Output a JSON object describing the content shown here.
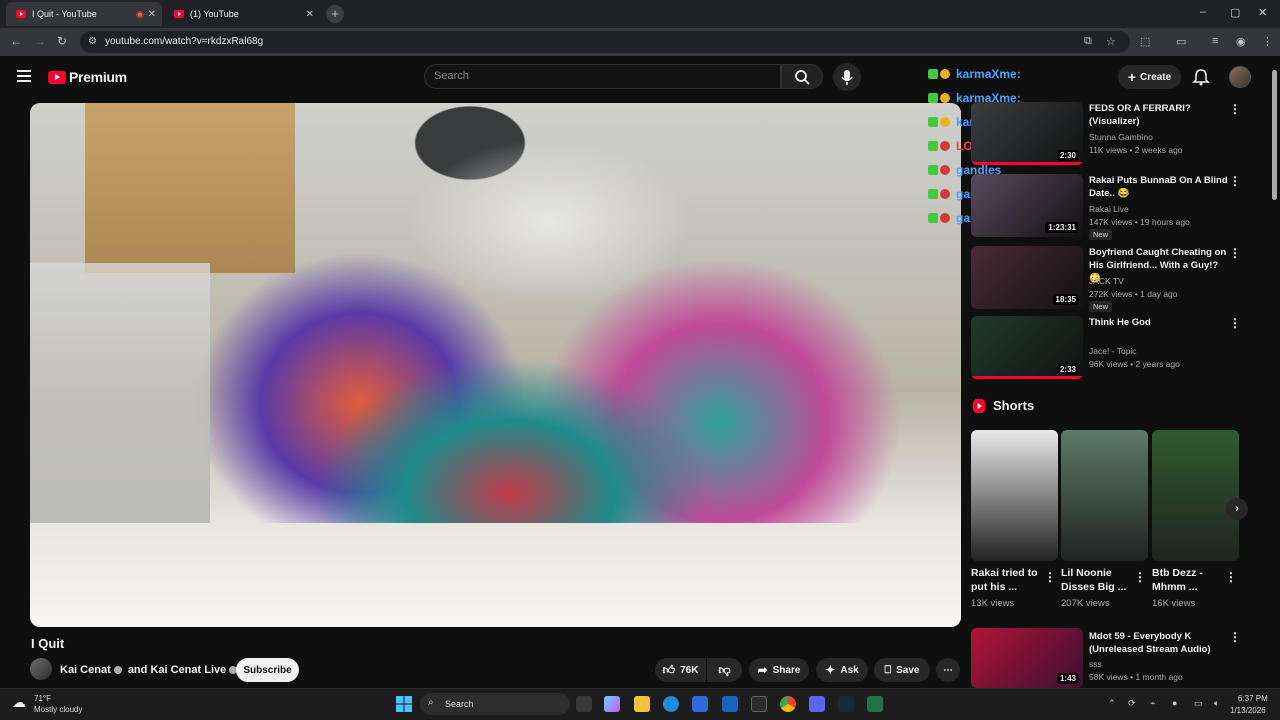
{
  "browser": {
    "tabs": [
      {
        "label": "I Quit - YouTube",
        "active": true
      },
      {
        "label": "(1) YouTube",
        "active": false
      }
    ],
    "new_tab": "+",
    "url": "youtube.com/watch?v=rkdzxRal68g",
    "window_controls": [
      "–",
      "▢",
      "✕"
    ]
  },
  "header": {
    "brand": "Premium",
    "search_placeholder": "Search",
    "create_label": "Create"
  },
  "chat": [
    {
      "user": "karmaXme:",
      "color": "#4da3ff"
    },
    {
      "user": "karmaXme:",
      "color": "#4da3ff"
    },
    {
      "user": "karmaXme:",
      "color": "#4da3ff"
    },
    {
      "user": "LOrdRick",
      "color": "#ff4040"
    },
    {
      "user": "gandles",
      "color": "#4da3ff"
    },
    {
      "user": "gan",
      "color": "#4da3ff"
    },
    {
      "user": "gan",
      "color": "#4da3ff"
    }
  ],
  "video": {
    "title": "I Quit",
    "channel": "Kai Cenat",
    "channel_joiner": "and",
    "channel2": "Kai Cenat Live",
    "subscribe": "Subscribe",
    "likes": "76K",
    "share": "Share",
    "ask": "Ask",
    "save": "Save"
  },
  "related": [
    {
      "title": "FEDS OR A FERRARI? (Visualizer)",
      "channel": "Stunna Gambino",
      "meta": "11K views • 2 weeks ago",
      "duration": "2:30",
      "new": "",
      "thumb": "#3a3d40"
    },
    {
      "title": "Rakai Puts BunnaB On A Blind Date.. 😂",
      "channel": "Rakai Live",
      "meta": "147K views • 19 hours ago",
      "duration": "1:23:31",
      "new": "New",
      "thumb": "#5a4a5e"
    },
    {
      "title": "Boyfriend Caught Cheating on His Girlfriend... With a Guy!? 😳",
      "channel": "JACK TV",
      "meta": "272K views • 1 day ago",
      "duration": "18:35",
      "new": "New",
      "thumb": "#4b2a35"
    },
    {
      "title": "Think He God",
      "channel": "Jace! - Topic",
      "meta": "96K views • 2 years ago",
      "duration": "2:33",
      "new": "",
      "thumb": "#1f3a2c"
    }
  ],
  "shorts": {
    "heading": "Shorts",
    "items": [
      {
        "title": "Rakai tried to put his ...",
        "views": "13K views",
        "thumb": "#e9e9e9"
      },
      {
        "title": "Lil Noonie Disses Big ...",
        "views": "207K views",
        "thumb": "#5b7a6a"
      },
      {
        "title": "Btb Dezz - Mhmm ...",
        "views": "16K views",
        "thumb": "#2f5b2d"
      }
    ]
  },
  "related_bottom": {
    "title": "Mdot 59 - Everybody K (Unreleased Stream Audio)",
    "channel": "sss",
    "meta": "58K views • 1 month ago",
    "duration": "1:43"
  },
  "taskbar": {
    "weather_temp": "71°F",
    "weather_desc": "Mostly cloudy",
    "search_label": "Search",
    "time": "6:37 PM",
    "date": "1/13/2026"
  },
  "colors": {
    "accent": "#ff0033",
    "bg": "#0f0f0f"
  }
}
